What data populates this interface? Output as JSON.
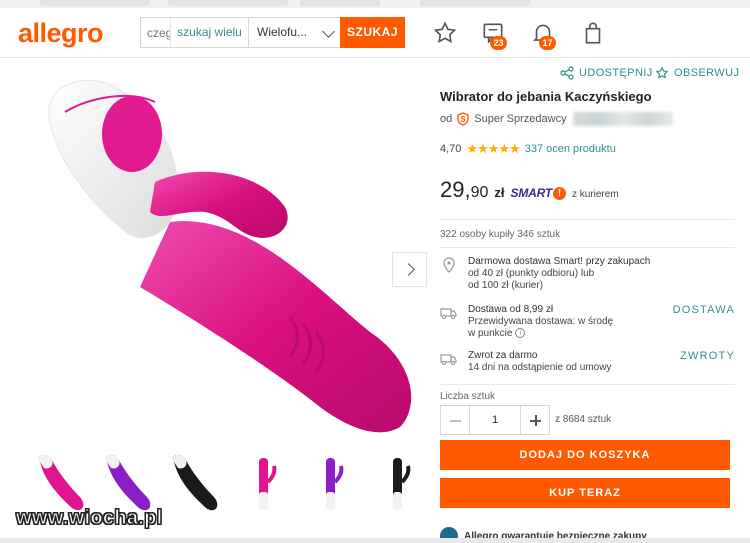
{
  "header": {
    "logo": "allegro",
    "search_placeholder": "czeg",
    "search_hint": "szukaj wielu",
    "category": "Wielofu...",
    "search_button": "SZUKAJ",
    "messages_count": "23",
    "notifications_count": "17"
  },
  "actions": {
    "share": "UDOSTĘPNIJ",
    "watch": "OBSERWUJ"
  },
  "product": {
    "title": "Wibrator do jebania Kaczyńskiego",
    "seller_prefix": "od",
    "seller_badge": "Super Sprzedawcy",
    "rating_value": "4,70",
    "stars": "★★★★★",
    "reviews": "337 ocen produktu",
    "price_int": "29,",
    "price_dec": "90",
    "currency": "zł",
    "smart_label": "SMART",
    "smart_bubble": "!",
    "courier": "z kurierem",
    "sold": "322 osoby kupiły 346 sztuk"
  },
  "delivery": {
    "smart_line1": "Darmowa dostawa Smart! przy zakupach",
    "smart_line2": "od 40 zł (punkty odbioru) lub",
    "smart_line3": "od 100 zł (kurier)",
    "shipping_line1": "Dostawa od 8,99 zł",
    "shipping_line2": "Przewidywana dostawa: w środę",
    "shipping_line3": "w punkcie",
    "shipping_link": "DOSTAWA",
    "return_line1": "Zwrot za darmo",
    "return_line2": "14 dni na odstąpienie od umowy",
    "return_link": "ZWROTY"
  },
  "purchase": {
    "qty_label": "Liczba sztuk",
    "qty_value": "1",
    "qty_of": "z 8684 sztuk",
    "add_to_cart": "DODAJ DO KOSZYKA",
    "buy_now": "KUP TERAZ",
    "guarantee": "Allegro gwarantuje bezpieczne zakupy"
  },
  "watermark": "www.wiocha.pl",
  "colors": {
    "accent": "#ff5a00",
    "link": "#2f8f8f",
    "product_pink": "#e0148c",
    "product_purple": "#8b1fc7",
    "star": "#ffae00"
  },
  "thumbnail_colors": [
    "pink",
    "purple",
    "black",
    "pink",
    "purple",
    "black"
  ]
}
